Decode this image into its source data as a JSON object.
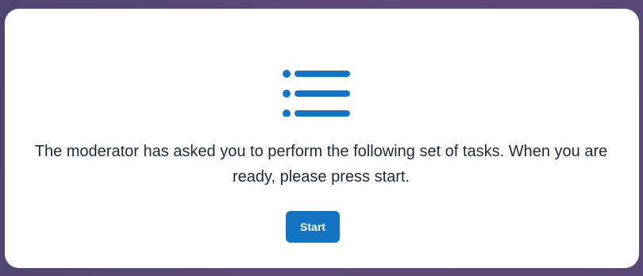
{
  "modal": {
    "icon": "list-icon",
    "message": "The moderator has asked you to perform the following set of tasks. When you are ready, please press start.",
    "start_label": "Start"
  },
  "colors": {
    "accent": "#1474c4",
    "text": "#1b2a3a",
    "card_background": "#ffffff",
    "page_background": "#56467a"
  }
}
